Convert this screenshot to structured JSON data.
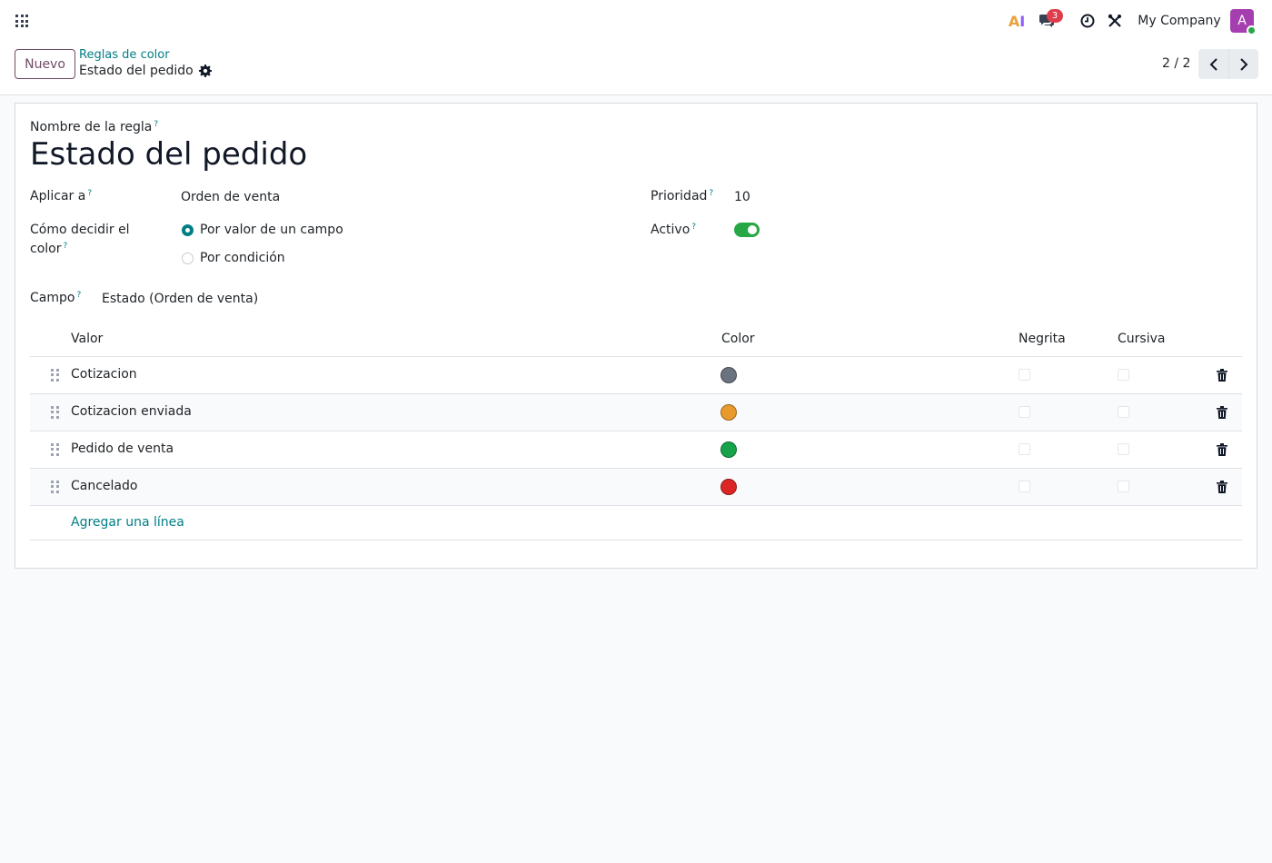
{
  "navbar": {
    "ai_label_a": "A",
    "ai_label_i": "I",
    "messages_badge": "3",
    "company": "My Company",
    "avatar_initial": "A",
    "icons": [
      "apps-icon",
      "ai-icon",
      "chat-icon",
      "clock-icon",
      "tools-icon"
    ]
  },
  "control_panel": {
    "new_button": "Nuevo",
    "breadcrumb_parent": "Reglas de color",
    "breadcrumb_current": "Estado del pedido",
    "pager": "2 / 2"
  },
  "form": {
    "name_label": "Nombre de la regla",
    "name_value": "Estado del pedido",
    "apply_label": "Aplicar a",
    "apply_value": "Orden de venta",
    "decide_label_1": "Cómo decidir el",
    "decide_label_2": "color",
    "radio_by_field": "Por valor de un campo",
    "radio_by_condition": "Por condición",
    "selected_mode": "by_field",
    "priority_label": "Prioridad",
    "priority_value": "10",
    "active_label": "Activo",
    "active": true,
    "field_label": "Campo",
    "field_value": "Estado (Orden de venta)",
    "tip": "?"
  },
  "table": {
    "headers": {
      "value": "Valor",
      "color": "Color",
      "bold": "Negrita",
      "italic": "Cursiva"
    },
    "rows": [
      {
        "value": "Cotizacion",
        "color": "#6b7280",
        "bold": false,
        "italic": false
      },
      {
        "value": "Cotizacion enviada",
        "color": "#e89a2c",
        "bold": false,
        "italic": false
      },
      {
        "value": "Pedido de venta",
        "color": "#16a34a",
        "bold": false,
        "italic": false
      },
      {
        "value": "Cancelado",
        "color": "#dc2626",
        "bold": false,
        "italic": false
      }
    ],
    "add_line": "Agregar una línea"
  },
  "colors": {
    "accent": "#017e84",
    "primary": "#714b67"
  }
}
